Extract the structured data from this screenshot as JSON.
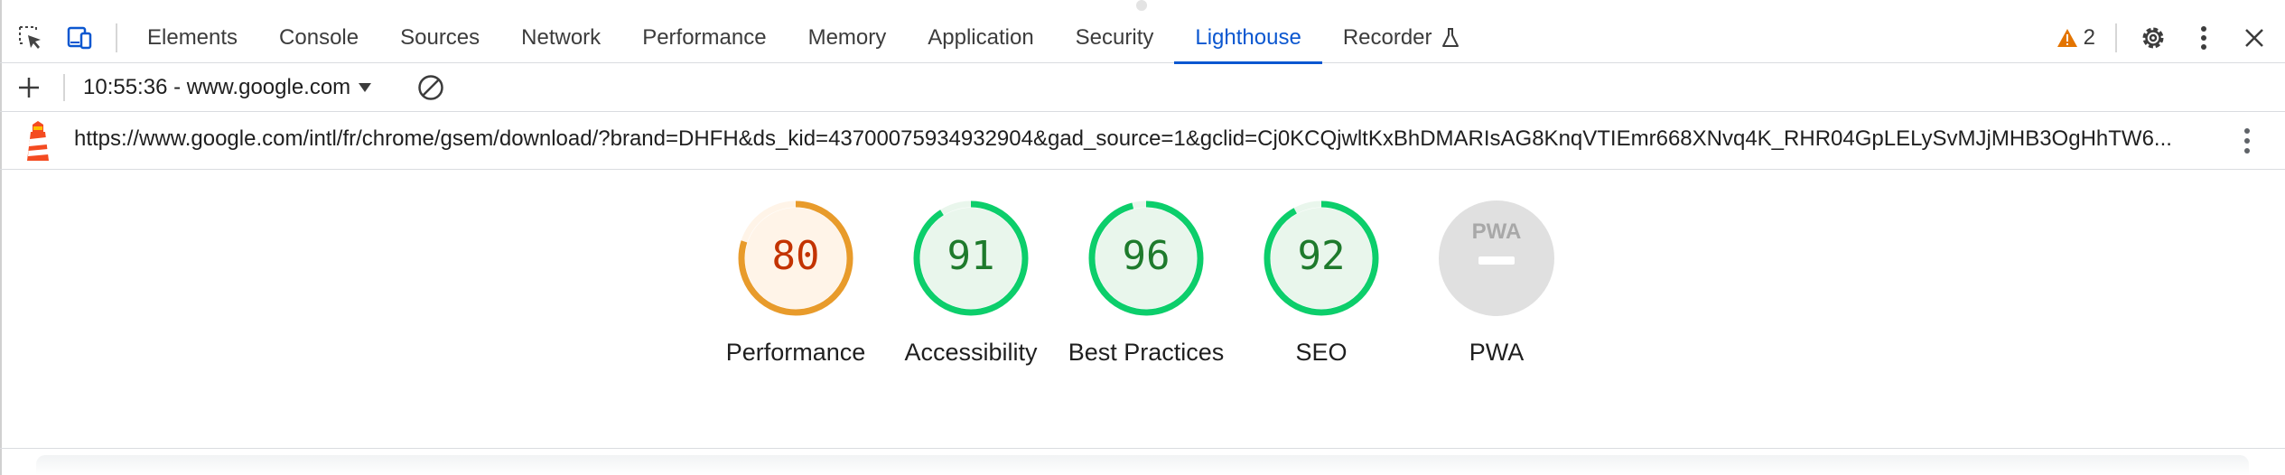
{
  "devtools": {
    "tabs": [
      {
        "label": "Elements",
        "active": false
      },
      {
        "label": "Console",
        "active": false
      },
      {
        "label": "Sources",
        "active": false
      },
      {
        "label": "Network",
        "active": false
      },
      {
        "label": "Performance",
        "active": false
      },
      {
        "label": "Memory",
        "active": false
      },
      {
        "label": "Application",
        "active": false
      },
      {
        "label": "Security",
        "active": false
      },
      {
        "label": "Lighthouse",
        "active": true
      },
      {
        "label": "Recorder",
        "active": false
      }
    ],
    "warnings_count": "2",
    "icons": {
      "inspect": "inspect-element-icon",
      "device": "device-toolbar-icon",
      "recorder": "flask-icon",
      "warning": "warning-icon",
      "settings": "gear-icon",
      "more": "more-vertical-icon",
      "close": "close-icon"
    },
    "colors": {
      "accent": "#0b57d0",
      "warning": "#e37400"
    }
  },
  "report": {
    "selected": "10:55:36 - www.google.com",
    "url": "https://www.google.com/intl/fr/chrome/gsem/download/?brand=DHFH&ds_kid=43700075934932904&gad_source=1&gclid=Cj0KCQjwltKxBhDMARIsAG8KnqVTIEmr668XNvq4K_RHR04GpLELySvMJjMHB3OgHhTW6..."
  },
  "scores": [
    {
      "label": "Performance",
      "value": "80",
      "score": 0.8,
      "status": "average",
      "color": "#e89b2b",
      "text_color": "#c33300",
      "fill": "#fff4e8"
    },
    {
      "label": "Accessibility",
      "value": "91",
      "score": 0.91,
      "status": "pass",
      "color": "#0cce6b",
      "text_color": "#1e7a2c",
      "fill": "#e9f6ec"
    },
    {
      "label": "Best Practices",
      "value": "96",
      "score": 0.96,
      "status": "pass",
      "color": "#0cce6b",
      "text_color": "#1e7a2c",
      "fill": "#e9f6ec"
    },
    {
      "label": "SEO",
      "value": "92",
      "score": 0.92,
      "status": "pass",
      "color": "#0cce6b",
      "text_color": "#1e7a2c",
      "fill": "#e9f6ec"
    },
    {
      "label": "PWA",
      "value": "PWA",
      "score": null,
      "status": "na",
      "color": "#dcdcdc",
      "text_color": "#9e9e9e",
      "fill": "#e0e0e0"
    }
  ]
}
